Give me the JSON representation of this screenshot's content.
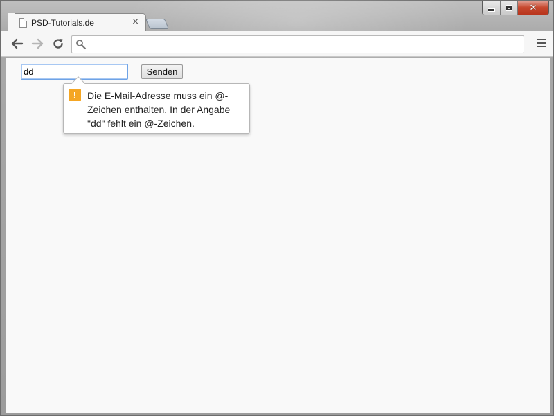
{
  "window": {
    "controls": {
      "minimize_icon": "minimize-icon",
      "maximize_icon": "maximize-icon",
      "close_icon": "close-icon",
      "close_glyph": "✕",
      "close_color": "#c7492f"
    }
  },
  "tabs": [
    {
      "title": "PSD-Tutorials.de",
      "close_glyph": "×",
      "icon": "page-icon"
    }
  ],
  "toolbar": {
    "back_icon": "arrow-left-icon",
    "forward_icon": "arrow-right-icon",
    "reload_icon": "reload-icon",
    "omnibox": {
      "value": "",
      "placeholder": "",
      "icon": "search-icon"
    },
    "menu_icon": "hamburger-menu-icon"
  },
  "form": {
    "email_value": "dd",
    "submit_label": "Senden",
    "focus_color": "#6fa3e6"
  },
  "validation_tooltip": {
    "icon": "warning-icon",
    "icon_glyph": "!",
    "icon_color": "#f5a623",
    "message": "Die E-Mail-Adresse muss ein @-Zeichen enthalten. In der Angabe \"dd\" fehlt ein @-Zeichen."
  }
}
